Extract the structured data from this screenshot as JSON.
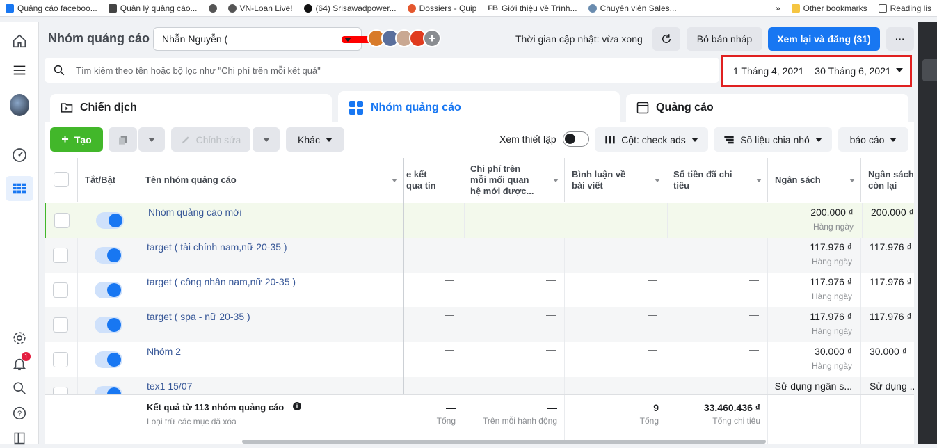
{
  "bookmarks": {
    "items": [
      {
        "label": "Quảng cáo faceboo...",
        "icon_color": "#1877f2"
      },
      {
        "label": "Quản lý quảng cáo...",
        "icon_color": "#444"
      },
      {
        "label": "",
        "icon_color": "#555"
      },
      {
        "label": "VN-Loan Live!",
        "icon_color": "#555"
      },
      {
        "label": "(64) Srisawadpower...",
        "icon_color": "#111"
      },
      {
        "label": "Dossiers - Quip",
        "icon_color": "#e4572e"
      },
      {
        "label": "Giới thiệu về Trình...",
        "icon_color": "#555"
      },
      {
        "label": "Chuyên viên Sales...",
        "icon_color": "#6a8caf"
      }
    ],
    "fb_label": "FB",
    "more": "»",
    "other": "Other bookmarks",
    "reading": "Reading lis"
  },
  "header": {
    "title": "Nhóm quảng cáo",
    "account": "Nhẫn Nguyễn (",
    "update_text": "Thời gian cập nhật: vừa xong",
    "discard_label": "Bỏ bản nháp",
    "publish_label": "Xem lại và đăng (31)",
    "more_label": "···"
  },
  "search": {
    "placeholder": "Tìm kiếm theo tên hoặc bộ lọc như \"Chi phí trên mỗi kết quả\""
  },
  "date_range": "1 Tháng 4, 2021 – 30 Tháng 6, 2021",
  "tabs": [
    {
      "label": "Chiến dịch"
    },
    {
      "label": "Nhóm quảng cáo"
    },
    {
      "label": "Quảng cáo"
    }
  ],
  "toolbar": {
    "create": "Tạo",
    "edit": "Chỉnh sửa",
    "more": "Khác",
    "view_setup": "Xem thiết lập",
    "columns": "Cột: check ads",
    "breakdown": "Số liệu chia nhỏ",
    "reports": "báo cáo"
  },
  "columns": {
    "toggle": "Tắt/Bật",
    "name": "Tên nhóm quảng cáo",
    "results": "e kết\nqua tin",
    "cost": "Chi phí trên\nmỗi mối quan\nhệ mới được...",
    "comments": "Bình luận về\nbài viết",
    "spent": "Số tiền đã chi\ntiêu",
    "budget": "Ngân sách",
    "remaining": "Ngân sách\ncòn lại"
  },
  "rows": [
    {
      "name": "Nhóm quảng cáo mới",
      "budget": "200.000 ₫",
      "budget_type": "Hàng ngày",
      "remaining": "200.000 ₫"
    },
    {
      "name": "target ( tài chính nam,nữ 20-35 )",
      "budget": "117.976 ₫",
      "budget_type": "Hàng ngày",
      "remaining": "117.976 ₫"
    },
    {
      "name": "target ( công nhân nam,nữ 20-35 )",
      "budget": "117.976 ₫",
      "budget_type": "Hàng ngày",
      "remaining": "117.976 ₫"
    },
    {
      "name": "target ( spa - nữ 20-35 )",
      "budget": "117.976 ₫",
      "budget_type": "Hàng ngày",
      "remaining": "117.976 ₫"
    },
    {
      "name": "Nhóm 2",
      "budget": "30.000 ₫",
      "budget_type": "Hàng ngày",
      "remaining": "30.000 ₫"
    },
    {
      "name": "tex1 15/07",
      "budget": "Sử dụng ngân s...",
      "budget_type": "",
      "remaining": "Sử dụng ..."
    }
  ],
  "dash": "—",
  "footer": {
    "title": "Kết quả từ 113 nhóm quảng cáo",
    "subtitle": "Loại trừ các mục đã xóa",
    "results_value": "—",
    "results_label": "Tổng",
    "cost_value": "—",
    "cost_label": "Trên mỗi hành động",
    "comments_value": "9",
    "comments_label": "Tổng",
    "spent_value": "33.460.436 ₫",
    "spent_label": "Tổng chi tiêu"
  },
  "notifications_badge": "1"
}
